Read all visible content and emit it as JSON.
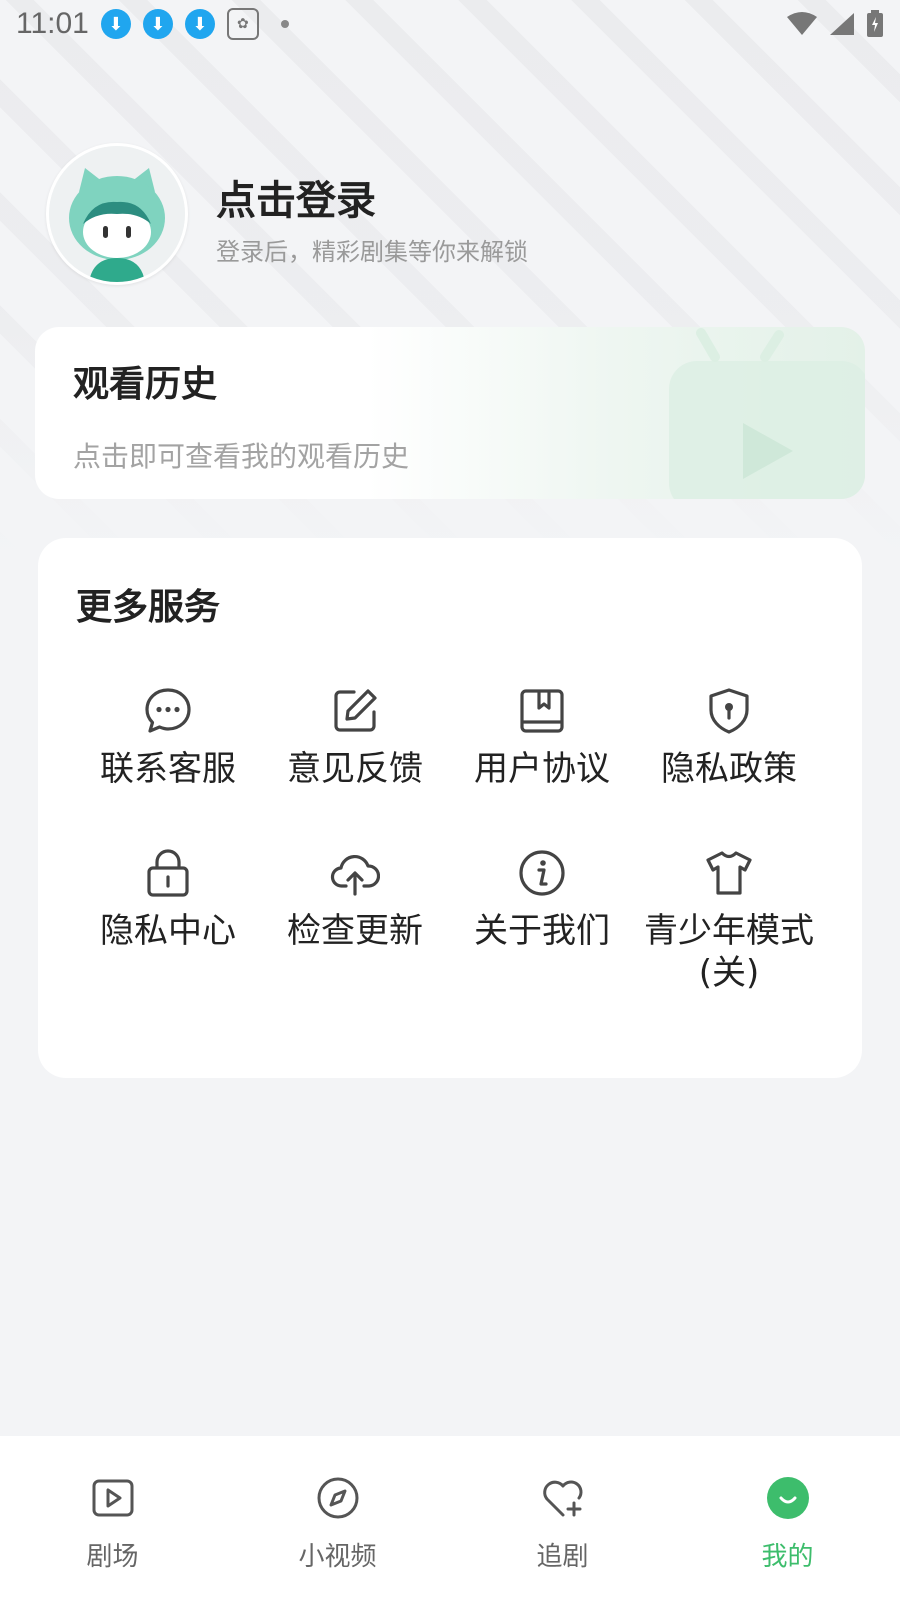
{
  "status_bar": {
    "time": "11:01"
  },
  "profile": {
    "title": "点击登录",
    "subtitle": "登录后，精彩剧集等你来解锁"
  },
  "history": {
    "title": "观看历史",
    "subtitle": "点击即可查看我的观看历史"
  },
  "services": {
    "title": "更多服务",
    "items": [
      {
        "label": "联系客服",
        "icon": "chat-bubble-icon"
      },
      {
        "label": "意见反馈",
        "icon": "edit-icon"
      },
      {
        "label": "用户协议",
        "icon": "book-icon"
      },
      {
        "label": "隐私政策",
        "icon": "shield-icon"
      },
      {
        "label": "隐私中心",
        "icon": "lock-icon"
      },
      {
        "label": "检查更新",
        "icon": "cloud-upload-icon"
      },
      {
        "label": "关于我们",
        "icon": "info-icon"
      },
      {
        "label": "青少年模式(关)",
        "icon": "shirt-icon"
      }
    ]
  },
  "nav": {
    "items": [
      {
        "label": "剧场",
        "icon": "play-screen-icon"
      },
      {
        "label": "小视频",
        "icon": "compass-icon"
      },
      {
        "label": "追剧",
        "icon": "heart-plus-icon"
      },
      {
        "label": "我的",
        "icon": "smile-icon"
      }
    ],
    "active_index": 3
  },
  "colors": {
    "accent": "#3dbd6c",
    "download_badge": "#20a6ef"
  }
}
